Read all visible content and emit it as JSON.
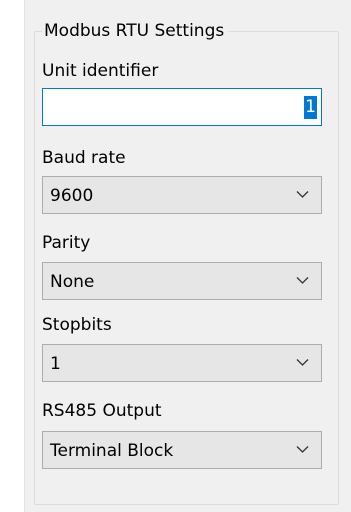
{
  "group": {
    "title": "Modbus RTU Settings"
  },
  "unit_identifier": {
    "label": "Unit identifier",
    "value": "1"
  },
  "baud_rate": {
    "label": "Baud rate",
    "value": "9600"
  },
  "parity": {
    "label": "Parity",
    "value": "None"
  },
  "stopbits": {
    "label": "Stopbits",
    "value": "1"
  },
  "rs485_output": {
    "label": "RS485 Output",
    "value": "Terminal Block"
  },
  "icons": {
    "dropdown": "chevron-down-icon"
  },
  "colors": {
    "selection": "#0078d7",
    "combo_background": "#e6e6e6",
    "panel_background": "#f0f0f0"
  }
}
